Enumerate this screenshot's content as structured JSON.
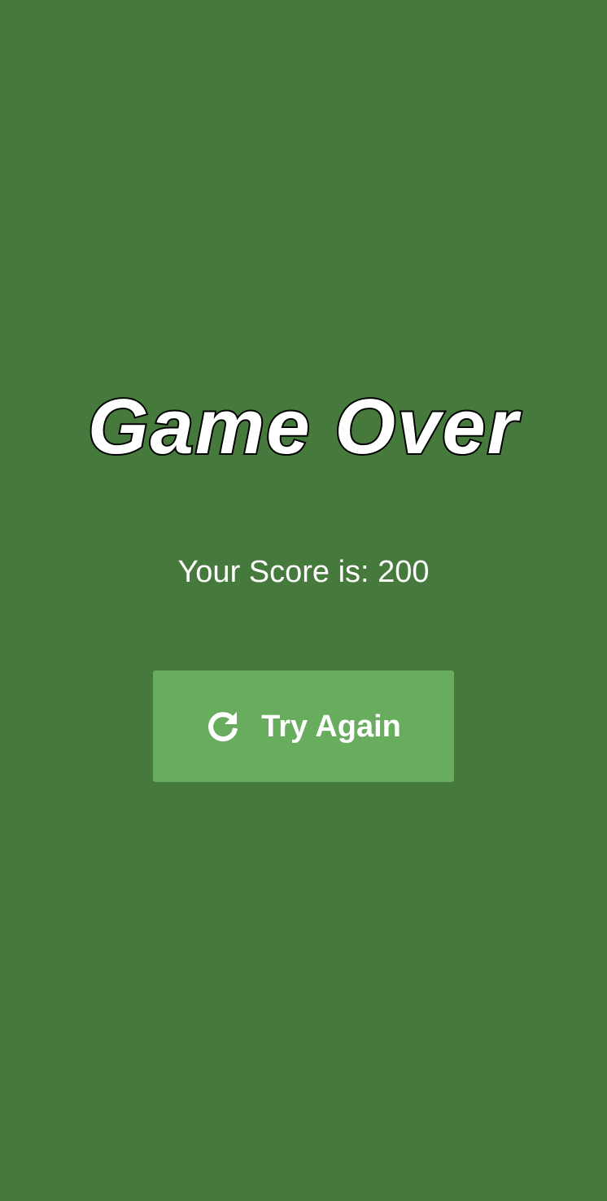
{
  "game_over": {
    "title": "Game Over",
    "score_text": "Your Score is: 200",
    "try_again_label": "Try Again",
    "try_again_icon": "refresh-icon"
  },
  "colors": {
    "background": "#457a3c",
    "button": "#68ad5e",
    "text": "#ffffff",
    "title_outline": "#000000"
  }
}
